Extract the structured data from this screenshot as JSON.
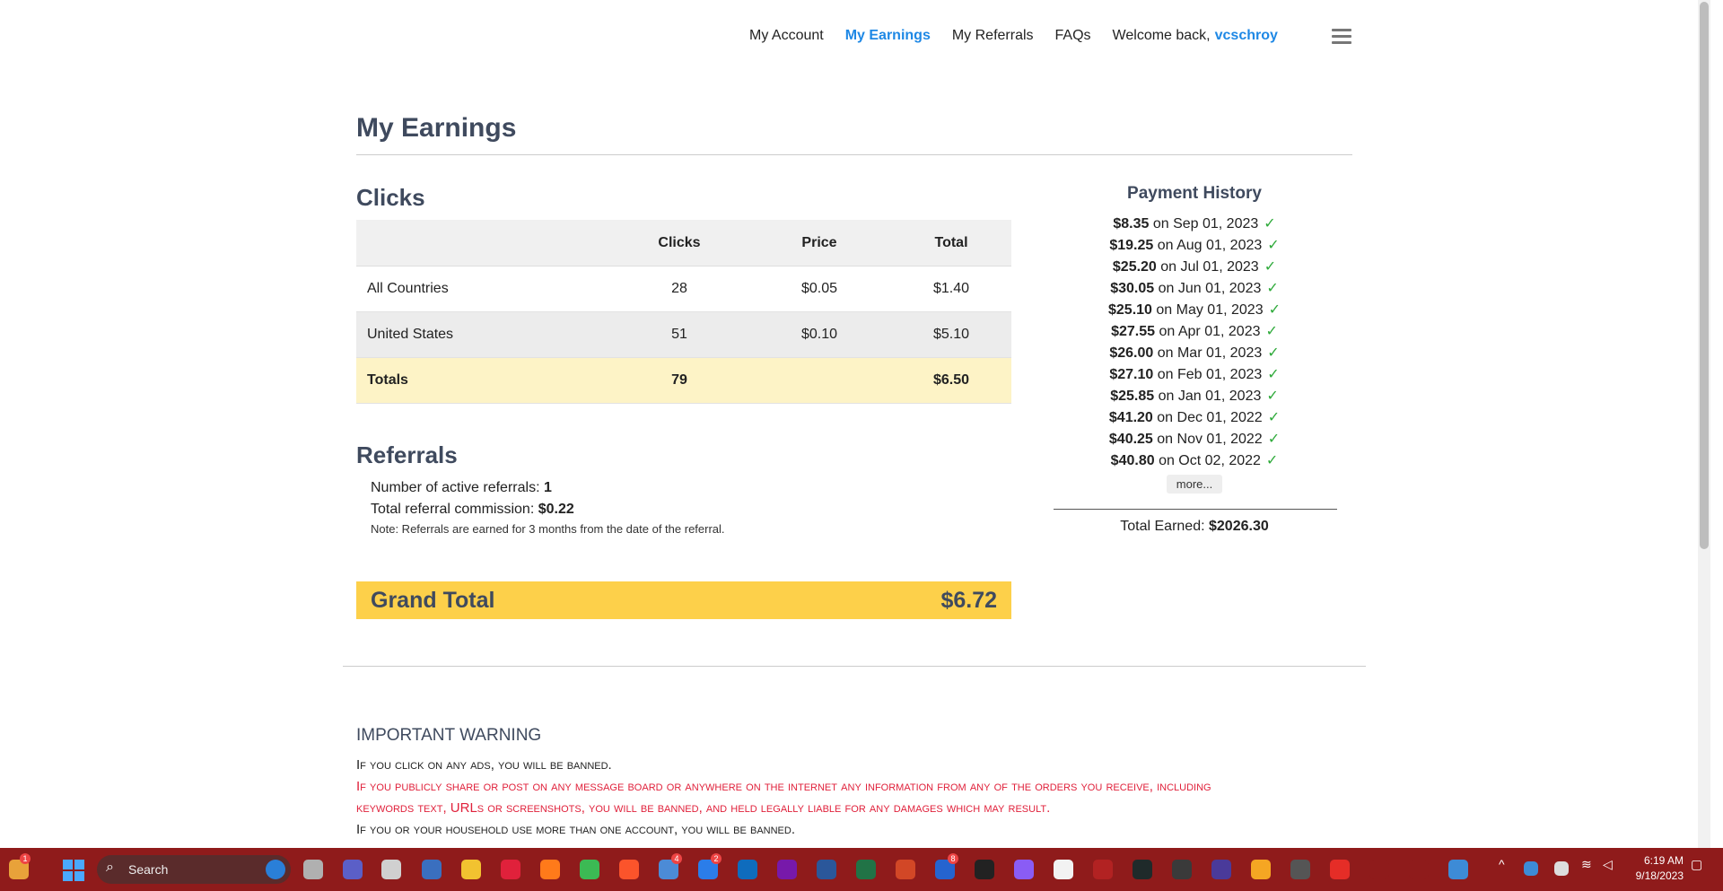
{
  "nav": {
    "items": [
      "My Account",
      "My Earnings",
      "My Referrals",
      "FAQs"
    ],
    "welcome": "Welcome back,",
    "username": "vcschroy"
  },
  "page": {
    "title": "My Earnings"
  },
  "clicks": {
    "heading": "Clicks",
    "columns": [
      "",
      "Clicks",
      "Price",
      "Total"
    ],
    "rows": [
      [
        "All Countries",
        "28",
        "$0.05",
        "$1.40"
      ],
      [
        "United States",
        "51",
        "$0.10",
        "$5.10"
      ]
    ],
    "totals": [
      "Totals",
      "79",
      "",
      "$6.50"
    ]
  },
  "referrals": {
    "heading": "Referrals",
    "active_label": "Number of active referrals:",
    "active_value": "1",
    "commission_label": "Total referral commission:",
    "commission_value": "$0.22",
    "note": "Note: Referrals are earned for 3 months from the date of the referral."
  },
  "grand_total": {
    "label": "Grand Total",
    "value": "$6.72"
  },
  "payment_history": {
    "title": "Payment History",
    "payments": [
      {
        "amount": "$8.35",
        "date": "on Sep 01, 2023"
      },
      {
        "amount": "$19.25",
        "date": "on Aug 01, 2023"
      },
      {
        "amount": "$25.20",
        "date": "on Jul 01, 2023"
      },
      {
        "amount": "$30.05",
        "date": "on Jun 01, 2023"
      },
      {
        "amount": "$25.10",
        "date": "on May 01, 2023"
      },
      {
        "amount": "$27.55",
        "date": "on Apr 01, 2023"
      },
      {
        "amount": "$26.00",
        "date": "on Mar 01, 2023"
      },
      {
        "amount": "$27.10",
        "date": "on Feb 01, 2023"
      },
      {
        "amount": "$25.85",
        "date": "on Jan 01, 2023"
      },
      {
        "amount": "$41.20",
        "date": "on Dec 01, 2022"
      },
      {
        "amount": "$40.25",
        "date": "on Nov 01, 2022"
      },
      {
        "amount": "$40.80",
        "date": "on Oct 02, 2022"
      }
    ],
    "check": "✓",
    "more_label": "more...",
    "total_label": "Total Earned:",
    "total_value": "$2026.30"
  },
  "warning": {
    "title": "IMPORTANT WARNING",
    "lines": [
      "If you click on any ads, you will be banned.",
      "If you publicly share or post on any message board or anywhere on the internet any information from any of the orders you receive, including",
      "keywords text, URLs or screenshots, you will be banned, and held legally liable for any damages which may result.",
      "If you or your household use more than one account, you will be banned."
    ]
  },
  "taskbar": {
    "search_placeholder": "Search",
    "time": "6:19 AM",
    "date": "9/18/2023",
    "badges": [
      "1",
      "4",
      "2",
      "8"
    ],
    "colors": {
      "bar": "#8f1b1b",
      "link": "#1e88e5",
      "warning_red": "#e0213b",
      "grand_total_bg": "#fdd04a"
    }
  }
}
